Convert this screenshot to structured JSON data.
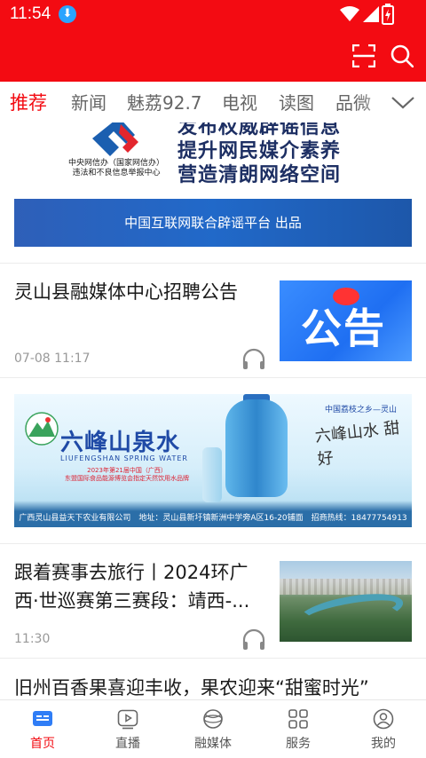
{
  "status_bar": {
    "time": "11:54"
  },
  "tabs": [
    {
      "label": "推荐",
      "active": true
    },
    {
      "label": "新闻"
    },
    {
      "label": "魅荔92.7"
    },
    {
      "label": "电视"
    },
    {
      "label": "读图"
    },
    {
      "label": "品微"
    }
  ],
  "banner_rumor": {
    "logo_line1": "中央网信办（国家网信办）",
    "logo_line2": "违法和不良信息举报中心",
    "slogan_line1": "发布权威辟谣信息",
    "slogan_line2": "提升网民媒介素养",
    "slogan_line3": "营造清朗网络空间",
    "platform": "中国互联网联合辟谣平台 出品"
  },
  "news": [
    {
      "title": "灵山县融媒体中心招聘公告",
      "time": "07-08 11:17",
      "thumb_text": "公告"
    },
    {
      "title": "跟着赛事去旅行丨2024环广西·世巡赛第三赛段：靖西-...",
      "time": "11:30"
    },
    {
      "title": "旧州百香果喜迎丰收，果农迎来“甜蜜时光”"
    }
  ],
  "ad_water": {
    "brand": "六峰山泉水",
    "brand_en": "LIUFENGSHAN SPRING WATER",
    "sub1": "2023年第21届中国（广西）",
    "sub2": "东盟国际食品能源博览会指定天然饮用水品牌",
    "tagline": "中国荔枝之乡—灵山",
    "calligraphy": "六峰山水 甜好",
    "footer": "广西灵山县益天下农业有限公司　地址：灵山县新圩镇新洲中学旁A区16-20铺面　招商热线：18477754913"
  },
  "bottom_nav": [
    {
      "label": "首页",
      "icon": "home-icon",
      "active": true
    },
    {
      "label": "直播",
      "icon": "live-icon"
    },
    {
      "label": "融媒体",
      "icon": "media-icon"
    },
    {
      "label": "服务",
      "icon": "services-icon"
    },
    {
      "label": "我的",
      "icon": "profile-icon"
    }
  ],
  "colors": {
    "accent": "#f30b12",
    "nav_active": "#f30b12",
    "blue": "#2a6fd0"
  }
}
